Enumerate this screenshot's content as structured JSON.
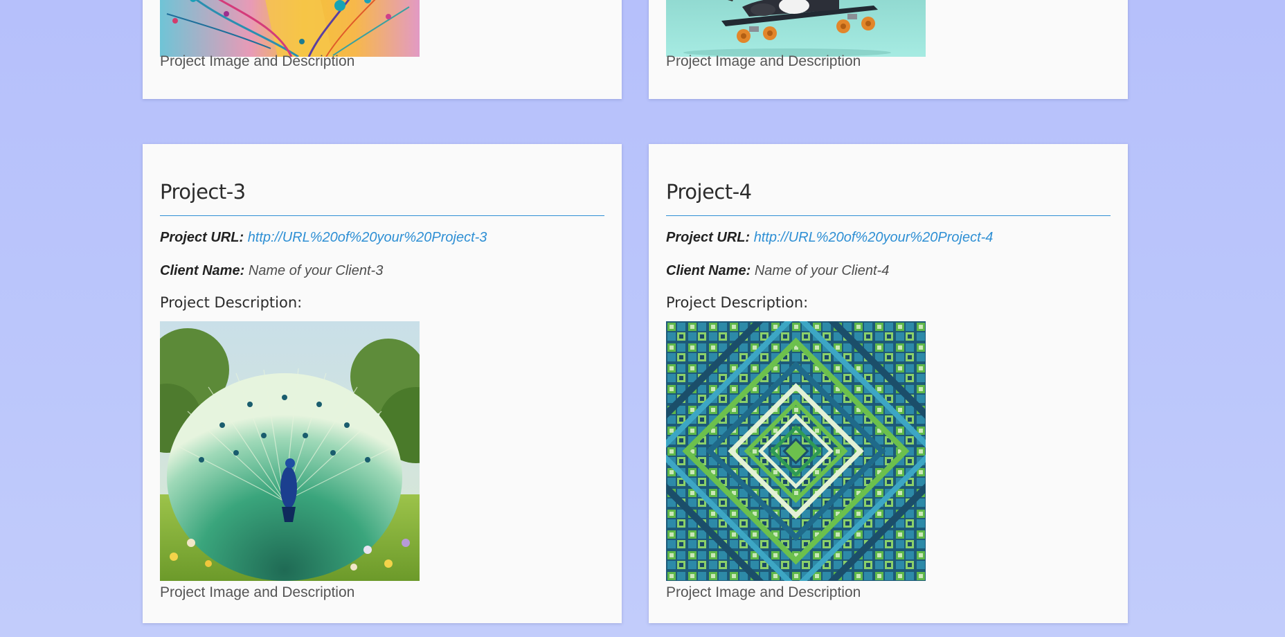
{
  "top_cards": [
    {
      "caption": "Project Image and Description"
    },
    {
      "caption": "Project Image and Description"
    }
  ],
  "projects": [
    {
      "title": "Project-3",
      "url_label": "Project URL:",
      "url": "http://URL%20of%20your%20Project-3",
      "client_label": "Client Name:",
      "client": "Name of your Client-3",
      "description_label": "Project Description:",
      "caption": "Project Image and Description"
    },
    {
      "title": "Project-4",
      "url_label": "Project URL:",
      "url": "http://URL%20of%20your%20Project-4",
      "client_label": "Client Name:",
      "client": "Name of your Client-4",
      "description_label": "Project Description:",
      "caption": "Project Image and Description"
    }
  ],
  "colors": {
    "background": "#b8c2fb",
    "card": "#fafafa",
    "accent": "#2e8fd4"
  }
}
